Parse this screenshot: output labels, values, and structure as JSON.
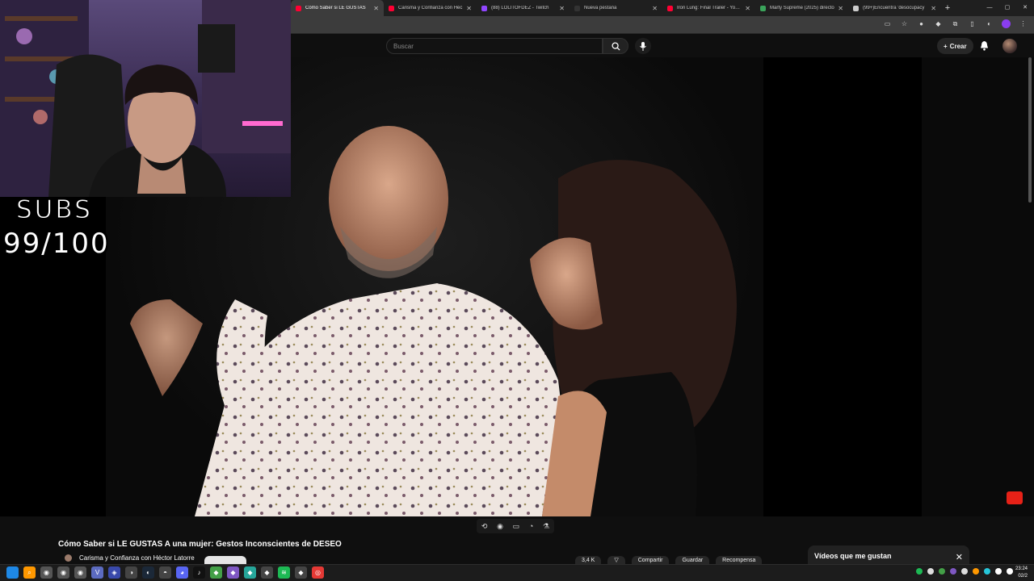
{
  "browser": {
    "tabs": [
      {
        "label": "Cómo Saber si LE GUSTAS",
        "active": true,
        "favicon_color": "#ff0033"
      },
      {
        "label": "Carisma y Confianza con Héc",
        "active": false,
        "favicon_color": "#ff0033"
      },
      {
        "label": "(88) LOLITOFDEZ - Twitch",
        "active": false,
        "favicon_color": "#9146ff"
      },
      {
        "label": "Nueva pestaña",
        "active": false,
        "favicon_color": "#333333"
      },
      {
        "label": "Iron Lung: Final Trailer - YouTu",
        "active": false,
        "favicon_color": "#ff0033"
      },
      {
        "label": "Marty Supreme (2025) directo",
        "active": false,
        "favicon_color": "#3aa35a"
      },
      {
        "label": "(99+)Encuentra 'desocupacy",
        "active": false,
        "favicon_color": "#cccccc"
      }
    ],
    "new_tab": "+"
  },
  "youtube": {
    "search_placeholder": "Buscar",
    "create_label": "Crear",
    "video_title": "Cómo Saber si LE GUSTAS A una mujer: Gestos Inconscientes de DESEO",
    "channel_name": "Carisma y Confianza con Héctor Latorre",
    "likes": "3,4 K",
    "share_label": "Compartir",
    "save_label": "Guardar",
    "thanks_label": "Recompensa",
    "liked_panel_title": "Vídeos que me gustan"
  },
  "overlay": {
    "subs_label": "SUBS",
    "subs_count": "99/100"
  },
  "taskbar": {
    "time": "23:24",
    "date": "02/2"
  }
}
